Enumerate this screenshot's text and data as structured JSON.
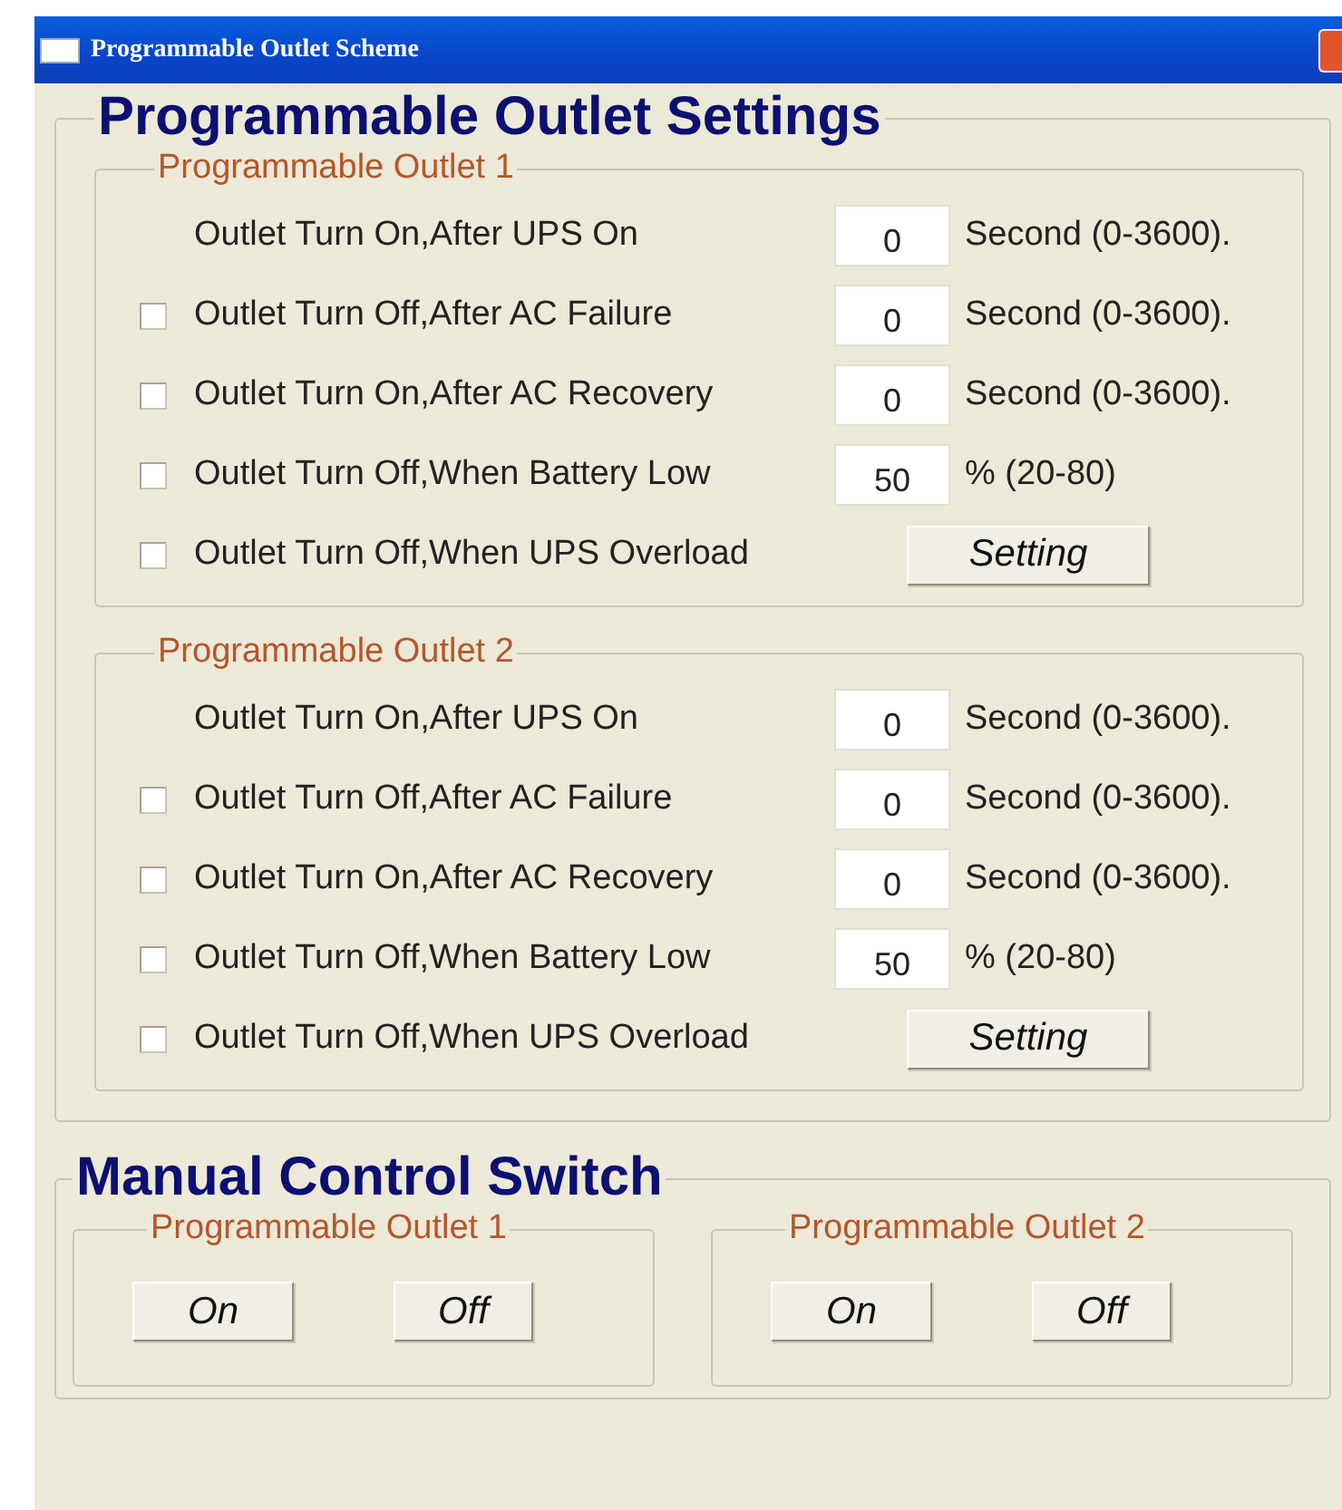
{
  "window": {
    "title": "Programmable Outlet Scheme"
  },
  "settings": {
    "title": "Programmable Outlet Settings",
    "outlets": [
      {
        "title": "Programmable Outlet 1",
        "rows": [
          {
            "kind": "input",
            "label": "Outlet Turn On,After UPS On",
            "value": "0",
            "unit": "Second (0-3600)."
          },
          {
            "kind": "check_input",
            "checked": false,
            "label": "Outlet Turn Off,After AC Failure",
            "value": "0",
            "unit": "Second (0-3600)."
          },
          {
            "kind": "check_input",
            "checked": false,
            "label": "Outlet Turn On,After AC Recovery",
            "value": "0",
            "unit": "Second (0-3600)."
          },
          {
            "kind": "check_input",
            "checked": false,
            "label": "Outlet Turn Off,When Battery Low",
            "value": "50",
            "unit": "% (20-80)"
          },
          {
            "kind": "check_button",
            "checked": false,
            "label": "Outlet Turn Off,When UPS Overload",
            "button": "Setting"
          }
        ]
      },
      {
        "title": "Programmable Outlet 2",
        "rows": [
          {
            "kind": "input",
            "label": "Outlet Turn On,After UPS On",
            "value": "0",
            "unit": "Second (0-3600)."
          },
          {
            "kind": "check_input",
            "checked": false,
            "label": "Outlet Turn Off,After AC Failure",
            "value": "0",
            "unit": "Second (0-3600)."
          },
          {
            "kind": "check_input",
            "checked": false,
            "label": "Outlet Turn On,After AC Recovery",
            "value": "0",
            "unit": "Second (0-3600)."
          },
          {
            "kind": "check_input",
            "checked": false,
            "label": "Outlet Turn Off,When Battery Low",
            "value": "50",
            "unit": "% (20-80)"
          },
          {
            "kind": "check_button",
            "checked": false,
            "label": "Outlet Turn Off,When UPS Overload",
            "button": "Setting"
          }
        ]
      }
    ]
  },
  "manual": {
    "title": "Manual Control Switch",
    "outlets": [
      {
        "title": "Programmable Outlet 1",
        "buttons": [
          "On",
          "Off"
        ]
      },
      {
        "title": "Programmable Outlet 2",
        "buttons": [
          "On",
          "Off"
        ]
      }
    ]
  }
}
